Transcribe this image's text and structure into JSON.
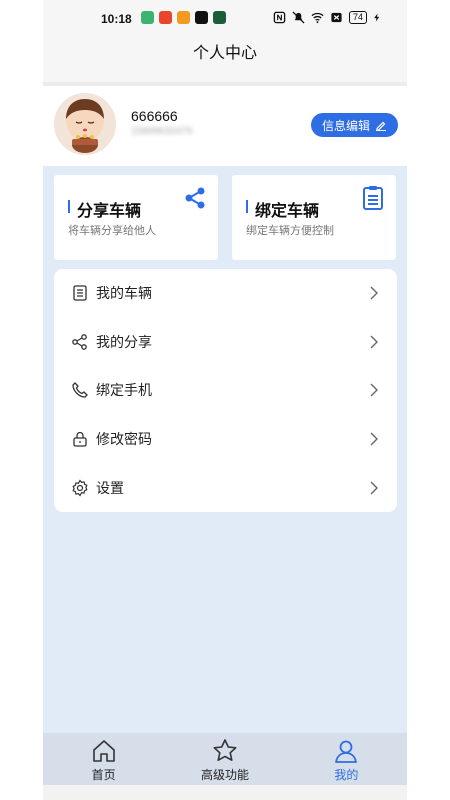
{
  "status_bar": {
    "time": "10:18",
    "battery": "74",
    "app_icons": [
      "app-icon-green",
      "app-icon-red",
      "app-icon-orange",
      "tiktok-icon",
      "app-icon-dark-green"
    ]
  },
  "header": {
    "title": "个人中心"
  },
  "profile": {
    "username": "666666",
    "phone": "15899632479",
    "edit_label": "信息编辑"
  },
  "cards": [
    {
      "title": "分享车辆",
      "subtitle": "将车辆分享给他人",
      "icon": "share-icon"
    },
    {
      "title": "绑定车辆",
      "subtitle": "绑定车辆方便控制",
      "icon": "clipboard-icon"
    }
  ],
  "menu": {
    "items": [
      {
        "label": "我的车辆",
        "icon": "list-icon"
      },
      {
        "label": "我的分享",
        "icon": "share-icon"
      },
      {
        "label": "绑定手机",
        "icon": "phone-icon"
      },
      {
        "label": "修改密码",
        "icon": "lock-icon"
      },
      {
        "label": "设置",
        "icon": "gear-icon"
      }
    ]
  },
  "tabbar": {
    "tabs": [
      {
        "label": "首页",
        "icon": "home-icon",
        "active": false
      },
      {
        "label": "高级功能",
        "icon": "star-icon",
        "active": false
      },
      {
        "label": "我的",
        "icon": "user-icon",
        "active": true
      }
    ]
  },
  "colors": {
    "accent": "#2e6de4",
    "background": "#e1ebf7"
  }
}
